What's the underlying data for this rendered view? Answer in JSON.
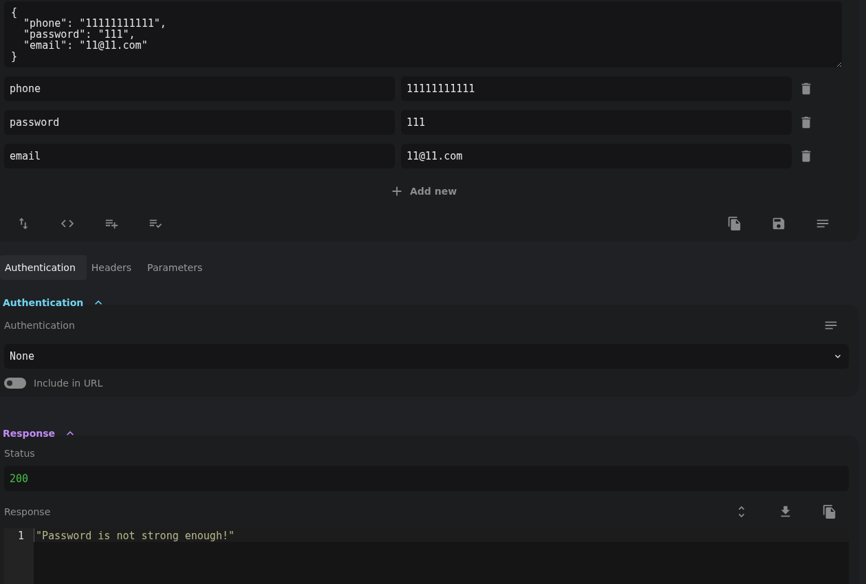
{
  "body_editor": {
    "text": "{\n  \"phone\": \"11111111111\",\n  \"password\": \"111\",\n  \"email\": \"11@11.com\"\n}"
  },
  "fields": [
    {
      "key": "phone",
      "value": "11111111111"
    },
    {
      "key": "password",
      "value": "111"
    },
    {
      "key": "email",
      "value": "11@11.com"
    }
  ],
  "add_button": {
    "label": "Add new"
  },
  "tabs": [
    {
      "label": "Authentication",
      "selected": true
    },
    {
      "label": "Headers",
      "selected": false
    },
    {
      "label": "Parameters",
      "selected": false
    }
  ],
  "auth_section": {
    "title": "Authentication",
    "expanded": true,
    "label": "Authentication",
    "select_value": "None",
    "include_in_url": {
      "label": "Include in URL",
      "on": false
    }
  },
  "response_section": {
    "title": "Response",
    "expanded": true,
    "status_label": "Status",
    "status": "200",
    "response_label": "Response",
    "lines": [
      {
        "number": "1",
        "text": "\"Password is not strong enough!\""
      }
    ]
  }
}
